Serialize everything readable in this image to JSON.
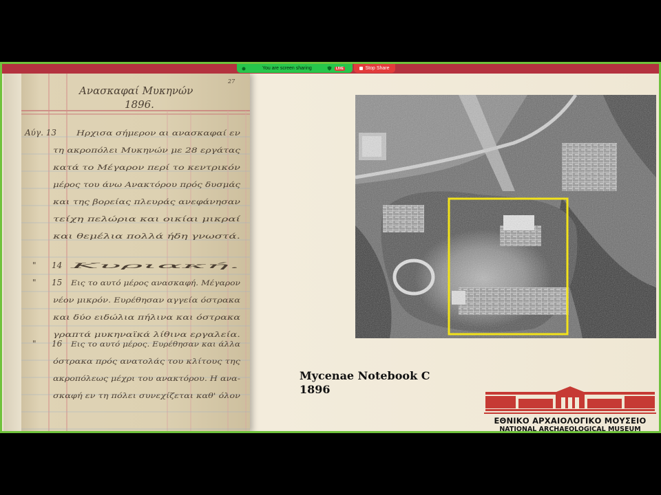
{
  "share_bar": {
    "status_text": "You are screen sharing",
    "live_badge": "LIVE",
    "stop_label": "Stop Share",
    "colors": {
      "frame": "#6fc23c",
      "strip": "#b4323f",
      "pill": "#27c64b",
      "stop": "#e23b3b"
    }
  },
  "notebook": {
    "title_line1": "Ανασκαφαί Μυκηνών",
    "title_line2": "1896.",
    "page_mark": "27",
    "margin_entries": [
      "Αύγ. 13",
      "14",
      "15",
      "16"
    ],
    "lines": [
      "Ηρχισα σήμερον αι ανασκαφαί εν",
      "τη ακροπόλει Μυκηνών με 28 εργάτας",
      "κατά το Μέγαρον περί το κεντρικόν",
      "μέρος του άνω Ανακτόρου πρός δυσμάς",
      "και της βορείας πλευράς ανεφάνησαν",
      "τείχη πελώρια και οικίαι μικραί",
      "και θεμέλια πολλά ήδη γνωστά.",
      "Κυριακή.",
      "Εις το αυτό μέρος ανασκαφή. Μέγαρον",
      "νέον μικρόν. Ευρέθησαν αγγεία όστρακα",
      "και δύο ειδώλια πήλινα και όστρακα",
      "γραπτά μυκηναϊκά λίθινα εργαλεία.",
      "Εις το αυτό μέρος. Ευρέθησαν και άλλα",
      "όστρακα πρός ανατολάς του κλίτους της",
      "ακροπόλεως μέχρι του ανακτόρου. Η ανα-",
      "σκαφή εν τη πόλει συνεχίζεται καθ' όλον"
    ]
  },
  "photo": {
    "highlight_color": "#f2e21a"
  },
  "caption": {
    "line1": "Mycenae Notebook C",
    "line2": "1896"
  },
  "museum": {
    "name_greek": "ΕΘΝΙΚΟ ΑΡΧΑΙΟΛΟΓΙΚΟ ΜΟΥΣΕΙΟ",
    "name_english": "NATIONAL ARCHAEOLOGICAL MUSEUM",
    "logo_color": "#c63a34"
  }
}
